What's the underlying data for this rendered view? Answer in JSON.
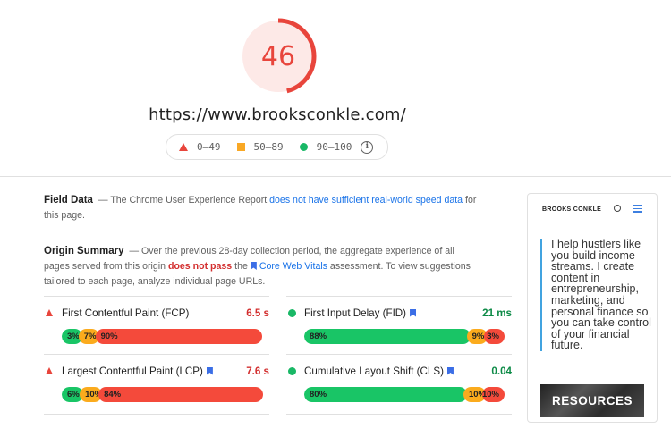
{
  "score": {
    "value": "46",
    "fraction": 0.46,
    "color": "#e8453c"
  },
  "url": "https://www.brooksconkle.com/",
  "legend": [
    {
      "icon": "red-triangle",
      "label": "0–49"
    },
    {
      "icon": "orange-square",
      "label": "50–89"
    },
    {
      "icon": "green-circle",
      "label": "90–100"
    }
  ],
  "field_data": {
    "title": "Field Data",
    "text_prefix": "— The Chrome User Experience Report ",
    "link": "does not have sufficient real-world speed data",
    "text_suffix": " for this page."
  },
  "origin_summary": {
    "title": "Origin Summary",
    "text_prefix": "— Over the previous 28-day collection period, the aggregate experience of all pages served from this origin ",
    "fail": "does not pass",
    "text_mid": " the ",
    "link": "Core Web Vitals",
    "text_suffix": " assessment. To view suggestions tailored to each page, analyze individual page URLs."
  },
  "metrics": [
    {
      "name": "First Contentful Paint (FCP)",
      "value": "6.5 s",
      "status": "poor",
      "core": false,
      "dist": [
        {
          "label": "3%",
          "pct": 3
        },
        {
          "label": "7%",
          "pct": 7
        },
        {
          "label": "90%",
          "pct": 90
        }
      ]
    },
    {
      "name": "First Input Delay (FID)",
      "value": "21 ms",
      "status": "good",
      "core": true,
      "dist": [
        {
          "label": "88%",
          "pct": 88
        },
        {
          "label": "9%",
          "pct": 9
        },
        {
          "label": "3%",
          "pct": 3
        }
      ]
    },
    {
      "name": "Largest Contentful Paint (LCP)",
      "value": "7.6 s",
      "status": "poor",
      "core": true,
      "dist": [
        {
          "label": "6%",
          "pct": 6
        },
        {
          "label": "10%",
          "pct": 10
        },
        {
          "label": "84%",
          "pct": 84
        }
      ]
    },
    {
      "name": "Cumulative Layout Shift (CLS)",
      "value": "0.04",
      "status": "good",
      "core": true,
      "dist": [
        {
          "label": "80%",
          "pct": 80
        },
        {
          "label": "10%",
          "pct": 10
        },
        {
          "label": "10%",
          "pct": 10
        }
      ]
    }
  ],
  "thumbnail": {
    "logo": "BROOKS CONKLE",
    "text": "I help hustlers like you build income streams. I create content in entrepreneurship, marketing, and personal finance so you can take control of your financial future.",
    "banner": "RESOURCES"
  },
  "colors": {
    "good": "#19c566",
    "average": "#fbab1d",
    "poor": "#f44a3b",
    "link": "#1a73e8"
  }
}
